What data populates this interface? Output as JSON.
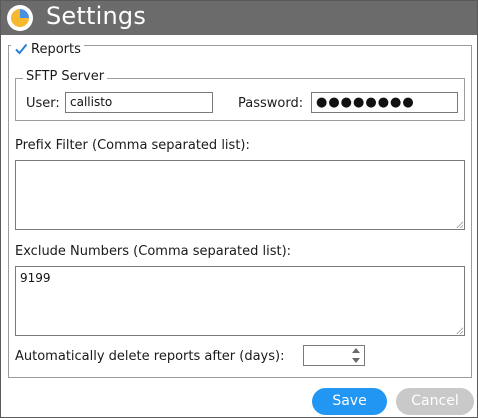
{
  "window": {
    "title": "Settings"
  },
  "reports": {
    "legend": "Reports",
    "checked": true,
    "sftp": {
      "legend": "SFTP Server",
      "user_label": "User:",
      "user_value": "callisto",
      "password_label": "Password:",
      "password_value": "●●●●●●●●"
    },
    "prefix_filter": {
      "label": "Prefix Filter (Comma separated list):",
      "value": ""
    },
    "exclude_numbers": {
      "label": "Exclude Numbers (Comma separated list):",
      "value": "9199"
    },
    "auto_delete": {
      "label": "Automatically delete reports after (days):",
      "value": ""
    }
  },
  "buttons": {
    "save": "Save",
    "cancel": "Cancel"
  },
  "colors": {
    "titlebar": "#6b6b6b",
    "save": "#2196f3",
    "cancel": "#c9c9c9",
    "check": "#2a7fd4"
  }
}
